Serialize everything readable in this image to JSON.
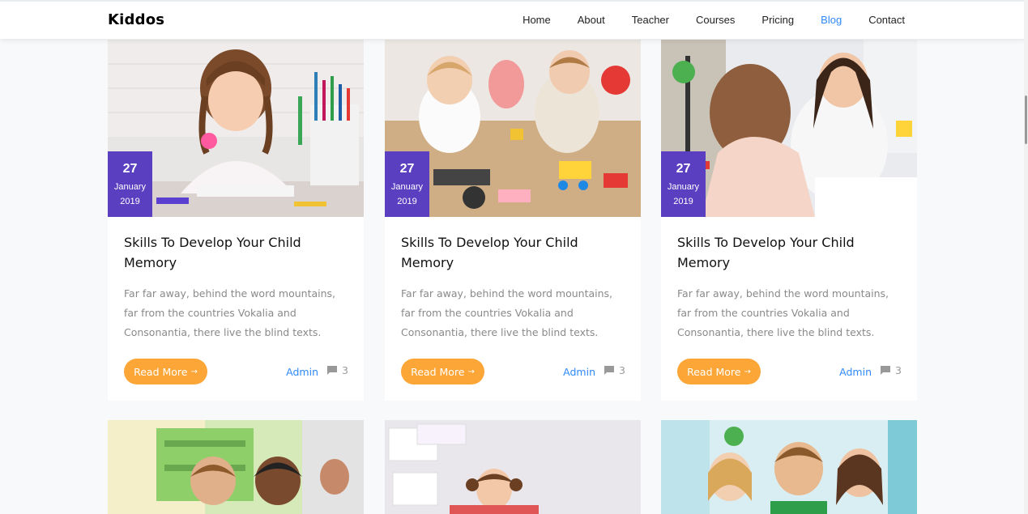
{
  "navbar": {
    "brand": "Kiddos",
    "links": [
      "Home",
      "About",
      "Teacher",
      "Courses",
      "Pricing",
      "Blog",
      "Contact"
    ],
    "active": "Blog"
  },
  "colors": {
    "accent": "#2f89fc",
    "date_badge": "#5a3fc0",
    "button": "#fda638"
  },
  "posts": [
    {
      "day": "27",
      "month": "January",
      "year": "2019",
      "title": "Skills To Develop Your Child Memory",
      "excerpt": "Far far away, behind the word mountains, far from the countries Vokalia and Consonantia, there live the blind texts.",
      "button": "Read More",
      "author": "Admin",
      "comments": "3",
      "image": "girl-drawing-photo"
    },
    {
      "day": "27",
      "month": "January",
      "year": "2019",
      "title": "Skills To Develop Your Child Memory",
      "excerpt": "Far far away, behind the word mountains, far from the countries Vokalia and Consonantia, there live the blind texts.",
      "button": "Read More",
      "author": "Admin",
      "comments": "3",
      "image": "toddlers-playing-photo"
    },
    {
      "day": "27",
      "month": "January",
      "year": "2019",
      "title": "Skills To Develop Your Child Memory",
      "excerpt": "Far far away, behind the word mountains, far from the countries Vokalia and Consonantia, there live the blind texts.",
      "button": "Read More",
      "author": "Admin",
      "comments": "3",
      "image": "teacher-student-photo"
    }
  ],
  "bottom_images": [
    "classroom-kids-photo",
    "girl-jumping-photo",
    "three-kids-photo"
  ]
}
